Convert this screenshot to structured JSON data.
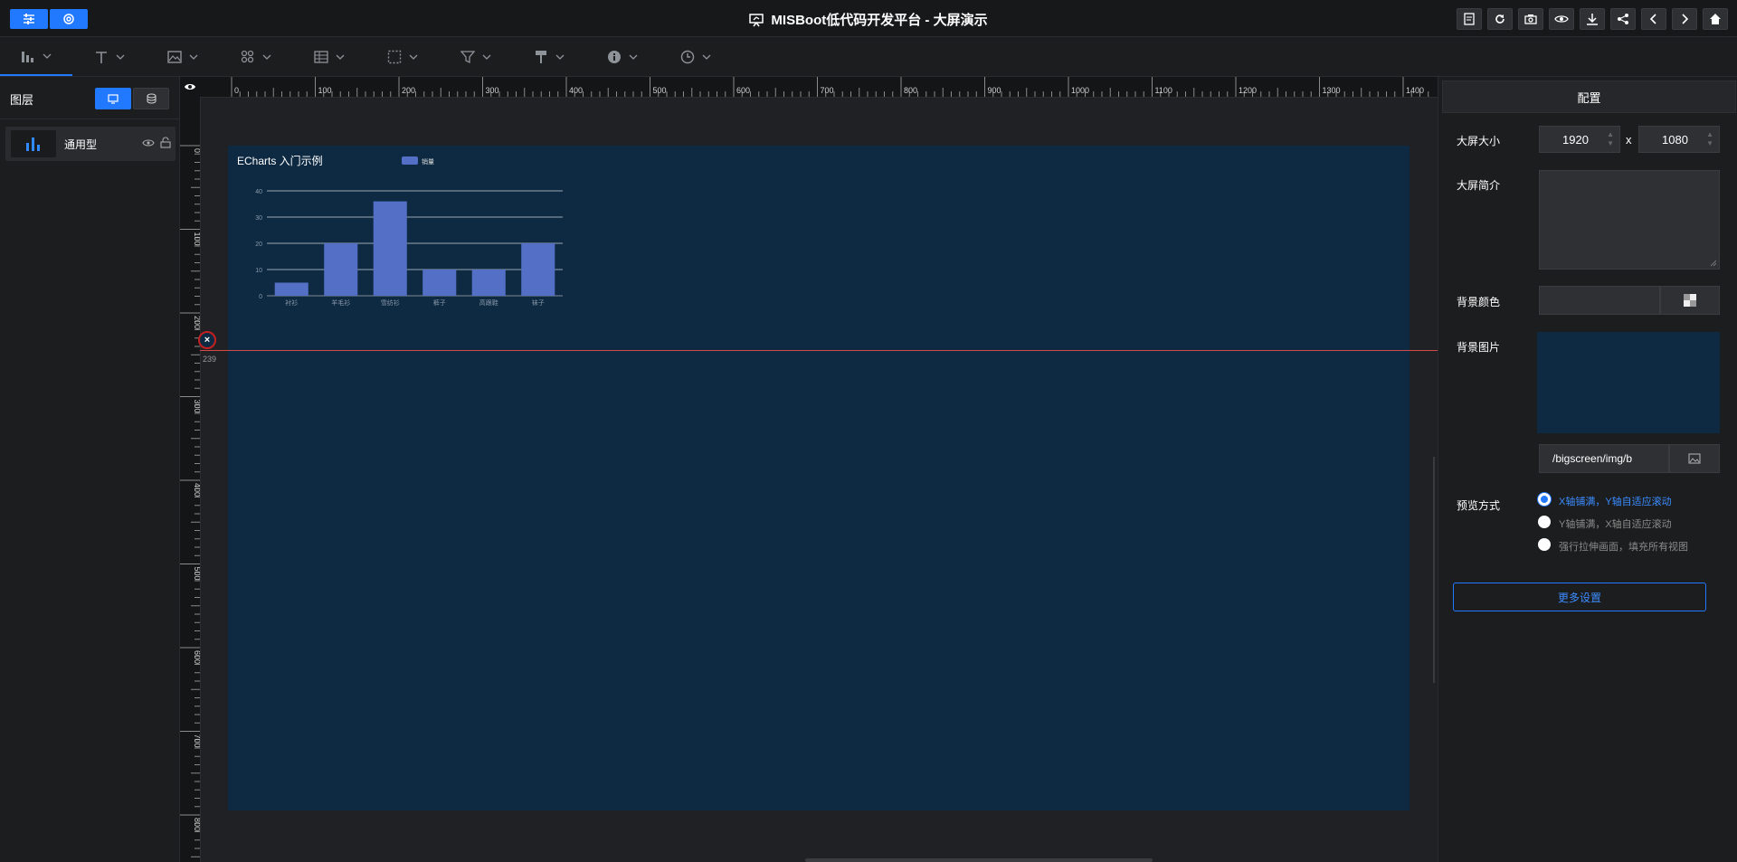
{
  "header": {
    "title": "MISBoot低代码开发平台 - 大屏演示",
    "left_buttons": [
      "sliders-icon",
      "gear-icon"
    ],
    "right_icons": [
      "notes-icon",
      "refresh-icon",
      "camera-icon",
      "eye-icon",
      "download-icon",
      "share-icon",
      "chevron-left-icon",
      "chevron-right-icon",
      "home-icon"
    ]
  },
  "toolbar": {
    "tools": [
      "bar-chart-icon",
      "text-icon",
      "image-icon",
      "component-icon",
      "table-icon",
      "frame-icon",
      "filter-icon",
      "paint-icon",
      "info-icon",
      "timer-icon"
    ]
  },
  "layers": {
    "title": "图层",
    "items": [
      {
        "name": "通用型"
      }
    ]
  },
  "rulers": {
    "top_ticks": [
      "0",
      "100",
      "200",
      "300",
      "400",
      "500",
      "600",
      "700",
      "800",
      "900",
      "1000",
      "1100",
      "1200",
      "1300",
      "1400"
    ],
    "left_ticks": [
      "0",
      "100",
      "200",
      "300",
      "400",
      "500",
      "600",
      "700",
      "800"
    ],
    "guide_value": "239"
  },
  "chart_data": {
    "type": "bar",
    "title": "ECharts 入门示例",
    "legend": [
      "销量"
    ],
    "legend_position": "top",
    "categories": [
      "衬衫",
      "羊毛衫",
      "雪纺衫",
      "裤子",
      "高跟鞋",
      "袜子"
    ],
    "series": [
      {
        "name": "销量",
        "values": [
          5,
          20,
          36,
          10,
          10,
          20
        ]
      }
    ],
    "ylim": [
      0,
      40
    ],
    "y_ticks": [
      "0",
      "10",
      "20",
      "30",
      "40"
    ],
    "grid": true,
    "bar_color": "#5470c6"
  },
  "config": {
    "header": "配置",
    "size_label": "大屏大小",
    "width": "1920",
    "x_sep": "x",
    "height": "1080",
    "intro_label": "大屏简介",
    "bgcolor_label": "背景颜色",
    "bgimage_label": "背景图片",
    "bgimage_path": "/bigscreen/img/b",
    "preview_label": "预览方式",
    "preview_options": [
      {
        "text": "X轴铺满，Y轴自适应滚动",
        "selected": true
      },
      {
        "text": "Y轴铺满，X轴自适应滚动",
        "selected": false
      },
      {
        "text": "强行拉伸画面，填充所有视图",
        "selected": false
      }
    ],
    "more_button": "更多设置"
  },
  "colors": {
    "accent": "#2079ff",
    "screen_bg": "#0e2a43",
    "guide": "#d34a4a"
  }
}
